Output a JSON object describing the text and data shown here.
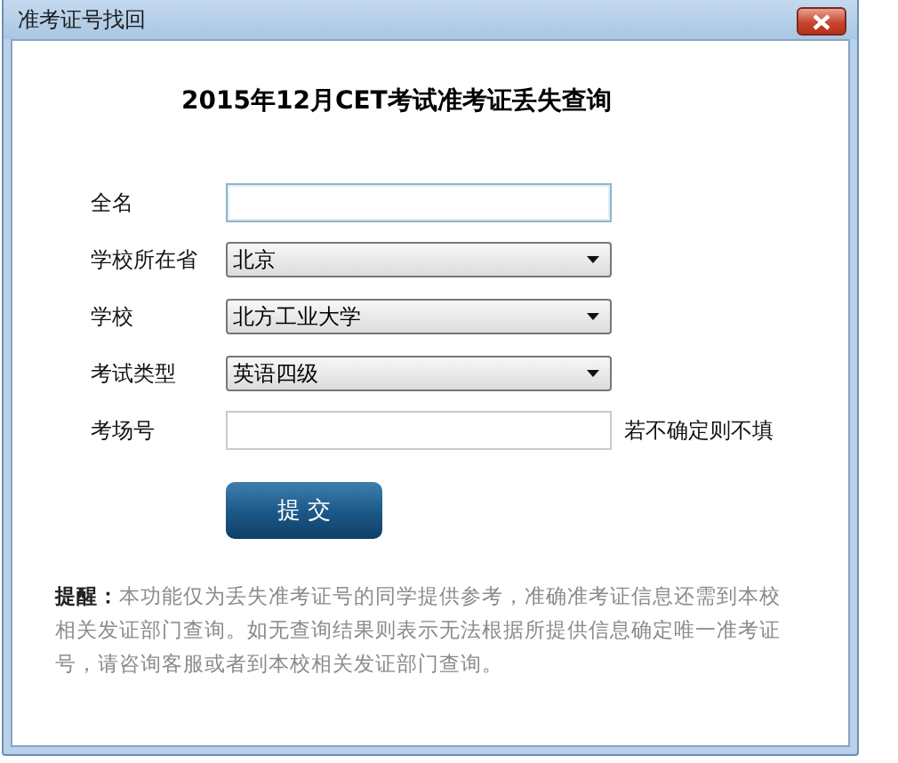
{
  "window": {
    "title": "准考证号找回"
  },
  "heading": "2015年12月CET考试准考证丢失查询",
  "fields": [
    {
      "kind": "text",
      "label": "全名",
      "focused": true
    },
    {
      "kind": "select",
      "label": "学校所在省",
      "value": "北京"
    },
    {
      "kind": "select",
      "label": "学校",
      "value": "北方工业大学"
    },
    {
      "kind": "select",
      "label": "考试类型",
      "value": "英语四级"
    },
    {
      "kind": "text",
      "label": "考场号",
      "focused": false,
      "hint": "若不确定则不填"
    }
  ],
  "submit": "提 交",
  "note": "**提醒：**本功能仅为丢失准考证号的同学提供参考，准确准考证信息还需到本校相关发证部门查询。如无查询结果则表示无法根据所提供信息确定唯一准考证号，请咨询客服或者到本校相关发证部门查询。"
}
